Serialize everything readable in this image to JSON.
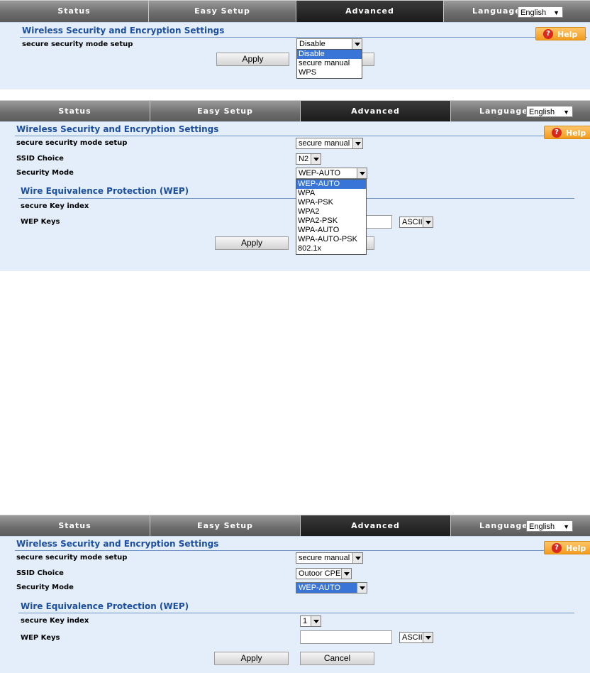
{
  "nav": {
    "status": "Status",
    "easy_setup": "Easy Setup",
    "advanced": "Advanced",
    "language_label": "Language",
    "language_value": "English"
  },
  "help": {
    "label": "Help"
  },
  "panel1": {
    "title": "Wireless Security and Encryption Settings",
    "mode_label": "secure security mode setup",
    "mode_value": "Disable",
    "mode_options": [
      "Disable",
      "secure manual",
      "WPS"
    ],
    "apply": "Apply"
  },
  "panel2": {
    "title": "Wireless Security and Encryption Settings",
    "mode_label": "secure security mode setup",
    "mode_value": "secure manual",
    "ssid_label": "SSID Choice",
    "ssid_value": "N2",
    "security_label": "Security Mode",
    "security_value": "WEP-AUTO",
    "security_options": [
      "WEP-AUTO",
      "WPA",
      "WPA-PSK",
      "WPA2",
      "WPA2-PSK",
      "WPA-AUTO",
      "WPA-AUTO-PSK",
      "802.1x"
    ],
    "wep_title": "Wire Equivalence Protection (WEP)",
    "key_index_label": "secure Key index",
    "wep_keys_label": "WEP Keys",
    "key_format": "ASCII",
    "apply": "Apply"
  },
  "panel3": {
    "title": "Wireless Security and Encryption Settings",
    "mode_label": "secure security mode setup",
    "mode_value": "secure manual",
    "ssid_label": "SSID Choice",
    "ssid_value": "Outoor CPE",
    "security_label": "Security Mode",
    "security_value": "WEP-AUTO",
    "wep_title": "Wire Equivalence Protection (WEP)",
    "key_index_label": "secure Key index",
    "key_index_value": "1",
    "wep_keys_label": "WEP Keys",
    "key_format": "ASCII",
    "apply": "Apply",
    "cancel": "Cancel"
  }
}
